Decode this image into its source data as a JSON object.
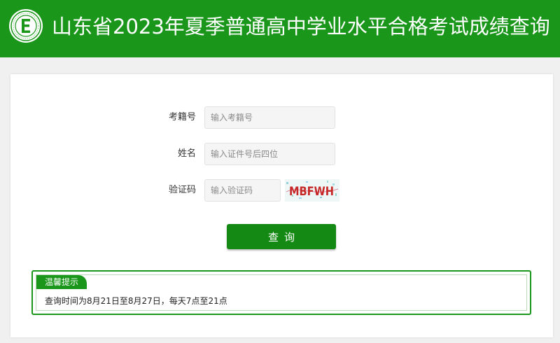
{
  "header": {
    "title": "山东省2023年夏季普通高中学业水平合格考试成绩查询",
    "logo_icon": "education-exam-logo-icon",
    "background_color": "#1a961a"
  },
  "form": {
    "exam_number": {
      "label": "考籍号",
      "placeholder": "输入考籍号",
      "value": ""
    },
    "name": {
      "label": "姓名",
      "placeholder": "输入证件号后四位",
      "value": ""
    },
    "captcha": {
      "label": "验证码",
      "placeholder": "输入验证码",
      "value": "",
      "image_text": "MBFWH"
    },
    "submit_label": "查询"
  },
  "notice": {
    "tag": "温馨提示",
    "text": "查询时间为8月21日至8月27日，每天7点至21点"
  },
  "colors": {
    "accent": "#1a961a",
    "button": "#148a14"
  }
}
